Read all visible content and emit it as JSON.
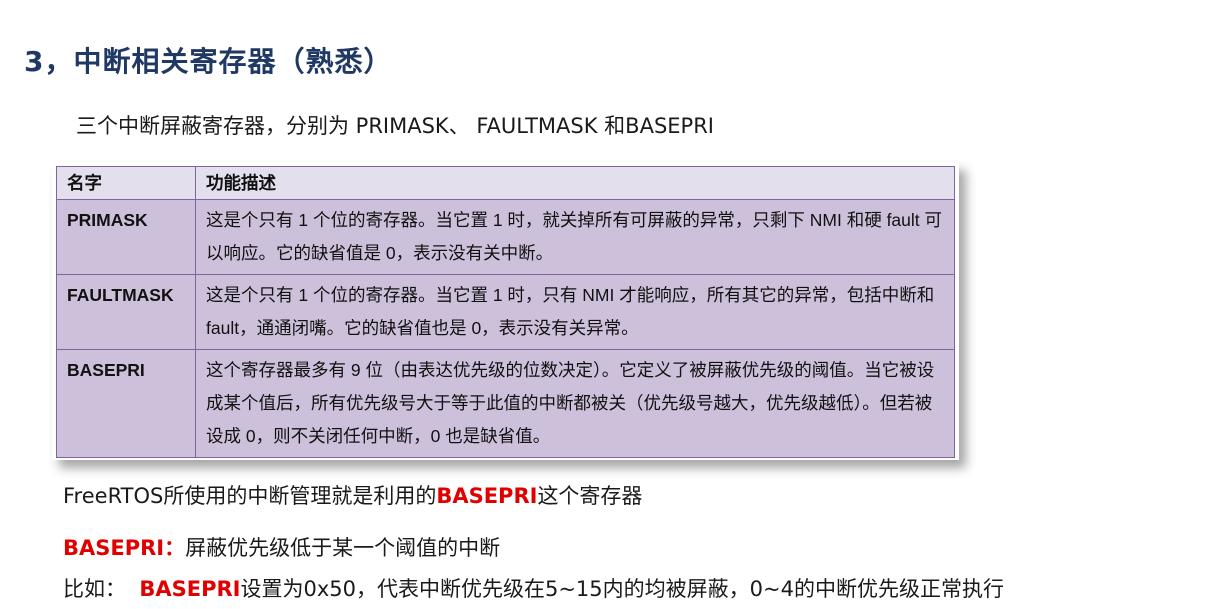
{
  "heading": "3，中断相关寄存器（熟悉）",
  "intro": "三个中断屏蔽寄存器，分别为 PRIMASK、 FAULTMASK 和BASEPRI",
  "table": {
    "headers": [
      "名字",
      "功能描述"
    ],
    "rows": [
      {
        "name": "PRIMASK",
        "desc": "这是个只有 1 个位的寄存器。当它置 1 时，就关掉所有可屏蔽的异常，只剩下 NMI 和硬 fault 可以响应。它的缺省值是 0，表示没有关中断。"
      },
      {
        "name": "FAULTMASK",
        "desc": "这是个只有 1 个位的寄存器。当它置 1 时，只有 NMI 才能响应，所有其它的异常，包括中断和 fault，通通闭嘴。它的缺省值也是 0，表示没有关异常。"
      },
      {
        "name": "BASEPRI",
        "desc": "这个寄存器最多有 9 位（由表达优先级的位数决定）。它定义了被屏蔽优先级的阈值。当它被设成某个值后，所有优先级号大于等于此值的中断都被关（优先级号越大，优先级越低）。但若被设成 0，则不关闭任何中断，0 也是缺省值。"
      }
    ]
  },
  "line1": {
    "pre": "FreeRTOS所使用的中断管理就是利用的",
    "highlight": "BASEPRI",
    "post": "这个寄存器"
  },
  "line2": {
    "highlight": "BASEPRI：",
    "post": "屏蔽优先级低于某一个阈值的中断"
  },
  "line3": {
    "pre": "比如：  ",
    "highlight": "BASEPRI",
    "post": "设置为0x50，代表中断优先级在5~15内的均被屏蔽，0~4的中断优先级正常执行"
  },
  "colors": {
    "heading": "#1f3864",
    "highlight": "#e00000",
    "table_fill": "#ccc0da",
    "table_border": "#8064a2"
  }
}
